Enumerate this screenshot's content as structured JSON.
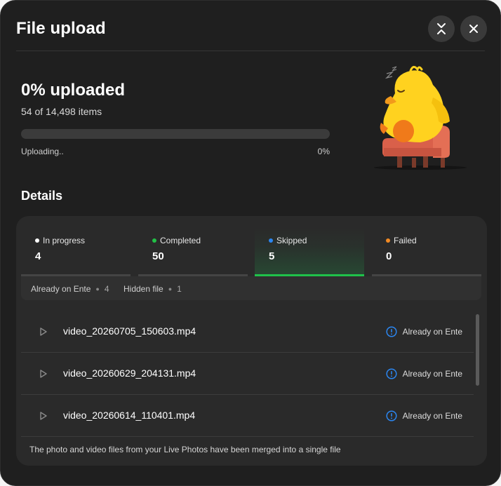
{
  "dialog": {
    "title": "File upload",
    "collapse_icon": "collapse-chevrons-icon",
    "close_icon": "close-icon"
  },
  "progress": {
    "heading": "0% uploaded",
    "items": "54 of 14,498 items",
    "status": "Uploading..",
    "percent_label": "0%",
    "percent_value": 0,
    "accent": "#1db954"
  },
  "illustration": {
    "name": "sleeping-duck-on-couch"
  },
  "details": {
    "title": "Details",
    "tabs": [
      {
        "label": "In progress",
        "count": "4",
        "color": "#ffffff"
      },
      {
        "label": "Completed",
        "count": "50",
        "color": "#21c046"
      },
      {
        "label": "Skipped",
        "count": "5",
        "color": "#2b86f0",
        "active": true
      },
      {
        "label": "Failed",
        "count": "0",
        "color": "#f28a24"
      }
    ],
    "filters": [
      {
        "label": "Already on Ente",
        "count": "4"
      },
      {
        "label": "Hidden file",
        "count": "1"
      }
    ],
    "files": [
      {
        "name": "video_20260705_150603.mp4",
        "status": "Already on Ente"
      },
      {
        "name": "video_20260629_204131.mp4",
        "status": "Already on Ente"
      },
      {
        "name": "video_20260614_110401.mp4",
        "status": "Already on Ente"
      }
    ],
    "status_color": "#2b86f0",
    "note": "The photo and video files from your Live Photos have been merged into a single file"
  }
}
